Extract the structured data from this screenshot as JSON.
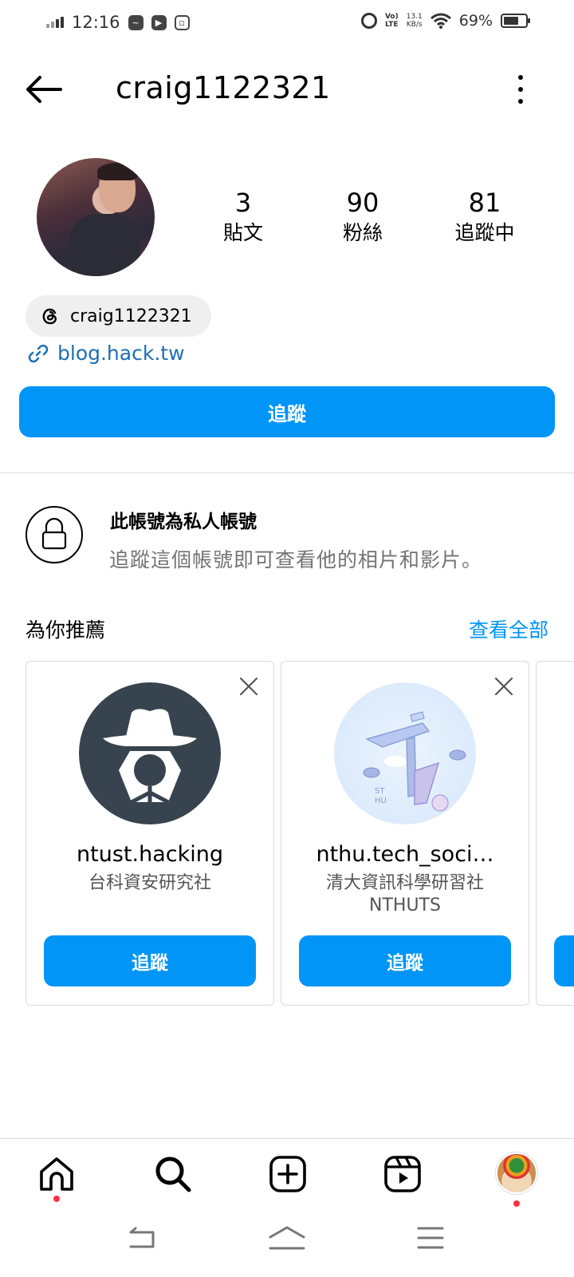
{
  "status_bar": {
    "time": "12:16",
    "volte_top": "Vo)",
    "volte_bottom": "LTE",
    "speed_top": "13.1",
    "speed_bottom": "KB/s",
    "battery_percent": "69%",
    "battery_level": 0.69
  },
  "header": {
    "username": "craig1122321"
  },
  "profile": {
    "posts": {
      "count": "3",
      "label": "貼文"
    },
    "followers": {
      "count": "90",
      "label": "粉絲"
    },
    "following": {
      "count": "81",
      "label": "追蹤中"
    },
    "threads_handle": "craig1122321",
    "link": "blog.hack.tw",
    "follow_label": "追蹤"
  },
  "private": {
    "title": "此帳號為私人帳號",
    "description": "追蹤這個帳號即可查看他的相片和影片。"
  },
  "suggestions": {
    "title": "為你推薦",
    "see_all": "查看全部",
    "cards": [
      {
        "name": "ntust.hacking",
        "subtitle": "台科資安研究社",
        "subtitle2": "",
        "follow_label": "追蹤"
      },
      {
        "name": "nthu.tech_soci…",
        "subtitle": "清大資訊科學研習社",
        "subtitle2": "NTHUTS",
        "follow_label": "追蹤"
      }
    ]
  },
  "colors": {
    "accent": "#0095f6",
    "link": "#1e6fb5",
    "notification_dot": "#ff3040"
  }
}
